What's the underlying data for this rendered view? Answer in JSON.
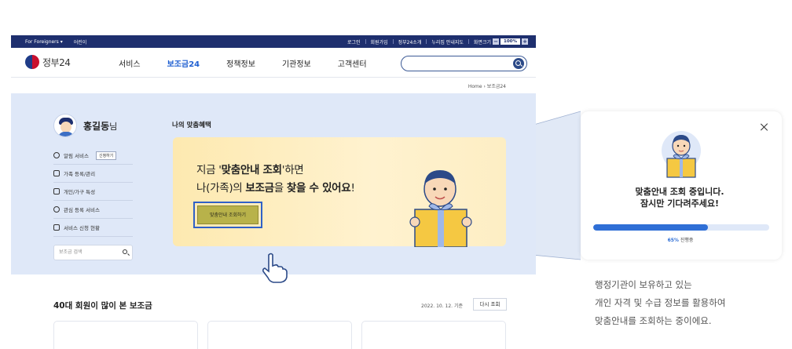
{
  "util_bar": {
    "foreigners": "For Foreigners",
    "foreigners_arrow": "▾",
    "kids": "어린이",
    "links": [
      "로그인",
      "회원가입",
      "정부24소개",
      "누리집 안내지도"
    ],
    "zoom_label": "화면크기",
    "zoom_minus": "−",
    "zoom_value": "100%",
    "zoom_plus": "+"
  },
  "header": {
    "logo_text": "정부24",
    "nav": [
      "서비스",
      "보조금24",
      "정책정보",
      "기관정보",
      "고객센터"
    ],
    "active_nav": "보조금24",
    "search_value": ""
  },
  "breadcrumb": {
    "home": "Home",
    "sep": "›",
    "current": "보조금24"
  },
  "user": {
    "name": "홍길동",
    "suffix": "님"
  },
  "sidebar": {
    "items": [
      {
        "label": "알림 서비스",
        "chip": "신청하기",
        "icon": "bell-icon"
      },
      {
        "label": "가족 등록/관리",
        "icon": "pencil-icon"
      },
      {
        "label": "개인/가구 특성",
        "icon": "building-icon"
      },
      {
        "label": "관심 등록 서비스",
        "icon": "heart-icon"
      },
      {
        "label": "서비스 신청 현황",
        "icon": "checklist-icon"
      }
    ],
    "search_placeholder": "보조금 검색"
  },
  "benefit": {
    "section_title": "나의 맞춤혜택",
    "line1_pre": "지금 '",
    "line1_bold": "맞춤안내 조회",
    "line1_post": "'하면",
    "line2_pre": "나(가족)의 ",
    "line2_bold1": "보조금",
    "line2_mid": "을 ",
    "line2_bold2": "찾을 수 있어요",
    "line2_post": "!",
    "cta_label": "맞춤안내 조회하기"
  },
  "popular": {
    "title": "40대 회원이 많이 본 보조금",
    "date": "2022. 10. 12. 기준",
    "refresh_label": "다시 조회"
  },
  "popup": {
    "message_line1": "맞춤안내 조회 중입니다.",
    "message_line2": "잠시만 기다려주세요!",
    "progress_percent": 65,
    "progress_pct_text": "65%",
    "progress_label": "진행중"
  },
  "caption": {
    "lines": [
      "행정기관이 보유하고 있는",
      "개인 자격 및 수급 정보를 활용하여",
      "맞춤안내를 조회하는 중이에요."
    ]
  },
  "colors": {
    "utility_bar": "#1e2f6e",
    "accent_blue": "#2f6fd6",
    "band_bg": "#dfe8f8",
    "card_yellow": "#fdeec4",
    "cta_olive": "#b8b24a"
  }
}
